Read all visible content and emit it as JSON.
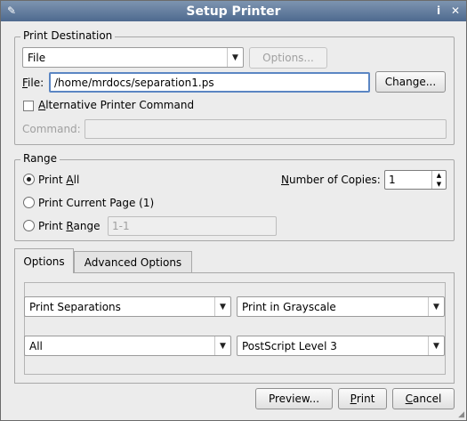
{
  "window": {
    "title": "Setup Printer",
    "pin_glyph": "✎",
    "info_glyph": "i",
    "close_glyph": "✕"
  },
  "print_destination": {
    "group_label": "Print Destination",
    "printer_selected": "File",
    "options_button": "Options...",
    "file_label_prefix": "F",
    "file_label_rest": "ile:",
    "file_value": "/home/mrdocs/separation1.ps",
    "change_button": "Change...",
    "alt_cmd_prefix": "A",
    "alt_cmd_rest": "lternative Printer Command",
    "command_label": "Command:",
    "command_value": ""
  },
  "range": {
    "group_label": "Range",
    "print_all_prefix": "Print ",
    "print_all_ul": "A",
    "print_all_rest": "ll",
    "print_current": "Print Current Page (1)",
    "print_range_prefix": "Print ",
    "print_range_ul": "R",
    "print_range_rest": "ange",
    "range_placeholder": "1-1",
    "copies_prefix": "N",
    "copies_rest": "umber of Copies:",
    "copies_value": "1"
  },
  "tabs": {
    "options": "Options",
    "advanced": "Advanced Options"
  },
  "options": {
    "separation_mode": "Print Separations",
    "color_mode": "Print in Grayscale",
    "separation_select": "All",
    "postscript_level": "PostScript Level 3"
  },
  "footer": {
    "preview_button": "Preview...",
    "print_prefix": "P",
    "print_rest": "rint",
    "cancel_prefix": "C",
    "cancel_rest": "ancel"
  },
  "colors": {
    "titlebar_top": "#7d94b0",
    "titlebar_bottom": "#4e6a8f",
    "focus_border": "#5b86c3"
  }
}
